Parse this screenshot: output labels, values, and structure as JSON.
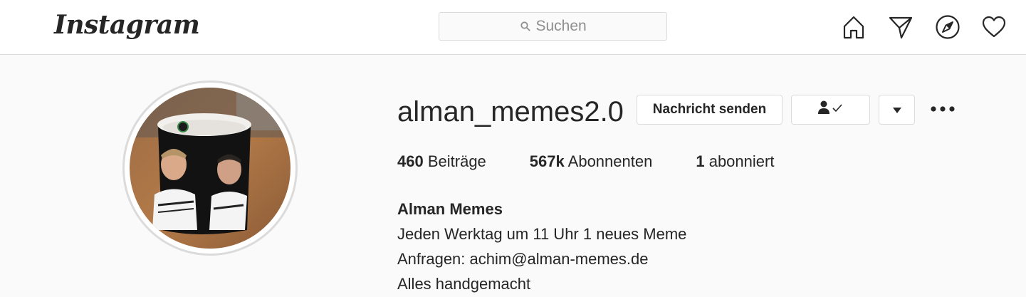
{
  "header": {
    "logo_text": "Instagram",
    "search": {
      "placeholder": "Suchen",
      "icon": "search-icon"
    },
    "nav_icons": [
      "home-icon",
      "direct-icon",
      "explore-icon",
      "activity-icon"
    ]
  },
  "profile": {
    "username": "alman_memes2.0",
    "message_button": "Nachricht senden",
    "following_button_icon": "person-check-icon",
    "dropdown_icon": "caret-down-icon",
    "more_icon": "more-icon",
    "stats": {
      "posts_count": "460",
      "posts_label": "Beiträge",
      "followers_count": "567k",
      "followers_label": "Abonnenten",
      "following_count": "1",
      "following_label": "abonniert"
    },
    "bio": {
      "name": "Alman Memes",
      "lines": [
        "Jeden Werktag um 11 Uhr 1 neues Meme",
        "Anfragen: achim@alman-memes.de",
        "Alles handgemacht"
      ]
    }
  },
  "colors": {
    "background": "#fafafa",
    "header_bg": "#ffffff",
    "border": "#dbdbdb",
    "text": "#262626",
    "muted": "#8e8e8e"
  }
}
